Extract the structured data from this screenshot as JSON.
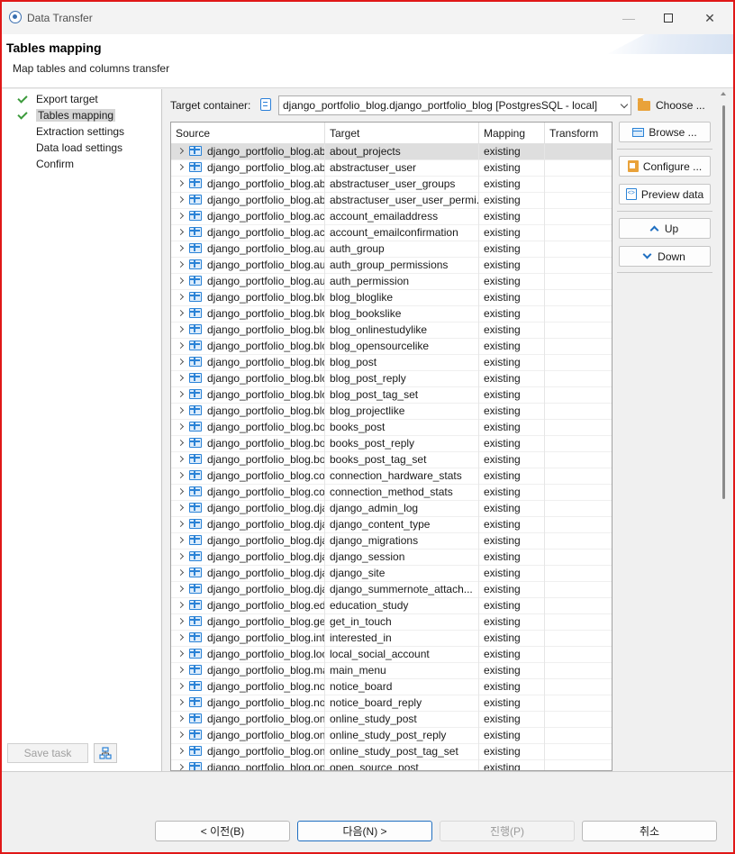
{
  "window": {
    "title": "Data Transfer"
  },
  "header": {
    "title": "Tables mapping",
    "subtitle": "Map tables and columns transfer"
  },
  "nav": {
    "items": [
      {
        "label": "Export target",
        "done": true
      },
      {
        "label": "Tables mapping",
        "done": true,
        "selected": true
      },
      {
        "label": "Extraction settings",
        "done": false
      },
      {
        "label": "Data load settings",
        "done": false
      },
      {
        "label": "Confirm",
        "done": false
      }
    ],
    "save_task_label": "Save task"
  },
  "target_container": {
    "label": "Target container:",
    "value": "django_portfolio_blog.django_portfolio_blog  [PostgresSQL - local]",
    "choose_label": "Choose ..."
  },
  "table": {
    "columns": [
      "Source",
      "Target",
      "Mapping",
      "Transform"
    ],
    "rows": [
      {
        "source": "django_portfolio_blog.about_projects",
        "target": "about_projects",
        "mapping": "existing",
        "transform": ""
      },
      {
        "source": "django_portfolio_blog.abstractuser_user",
        "target": "abstractuser_user",
        "mapping": "existing",
        "transform": ""
      },
      {
        "source": "django_portfolio_blog.abstractuser_user_groups",
        "target": "abstractuser_user_groups",
        "mapping": "existing",
        "transform": ""
      },
      {
        "source": "django_portfolio_blog.abstractuser_user_user_permissions",
        "target": "abstractuser_user_user_permi...",
        "mapping": "existing",
        "transform": ""
      },
      {
        "source": "django_portfolio_blog.account_emailaddress",
        "target": "account_emailaddress",
        "mapping": "existing",
        "transform": ""
      },
      {
        "source": "django_portfolio_blog.account_emailconfirmation",
        "target": "account_emailconfirmation",
        "mapping": "existing",
        "transform": ""
      },
      {
        "source": "django_portfolio_blog.auth_group",
        "target": "auth_group",
        "mapping": "existing",
        "transform": ""
      },
      {
        "source": "django_portfolio_blog.auth_group_permissions",
        "target": "auth_group_permissions",
        "mapping": "existing",
        "transform": ""
      },
      {
        "source": "django_portfolio_blog.auth_permission",
        "target": "auth_permission",
        "mapping": "existing",
        "transform": ""
      },
      {
        "source": "django_portfolio_blog.blog_bloglike",
        "target": "blog_bloglike",
        "mapping": "existing",
        "transform": ""
      },
      {
        "source": "django_portfolio_blog.blog_bookslike",
        "target": "blog_bookslike",
        "mapping": "existing",
        "transform": ""
      },
      {
        "source": "django_portfolio_blog.blog_onlinestudylike",
        "target": "blog_onlinestudylike",
        "mapping": "existing",
        "transform": ""
      },
      {
        "source": "django_portfolio_blog.blog_opensourcelike",
        "target": "blog_opensourcelike",
        "mapping": "existing",
        "transform": ""
      },
      {
        "source": "django_portfolio_blog.blog_post",
        "target": "blog_post",
        "mapping": "existing",
        "transform": ""
      },
      {
        "source": "django_portfolio_blog.blog_post_reply",
        "target": "blog_post_reply",
        "mapping": "existing",
        "transform": ""
      },
      {
        "source": "django_portfolio_blog.blog_post_tag_set",
        "target": "blog_post_tag_set",
        "mapping": "existing",
        "transform": ""
      },
      {
        "source": "django_portfolio_blog.blog_projectlike",
        "target": "blog_projectlike",
        "mapping": "existing",
        "transform": ""
      },
      {
        "source": "django_portfolio_blog.books_post",
        "target": "books_post",
        "mapping": "existing",
        "transform": ""
      },
      {
        "source": "django_portfolio_blog.books_post_reply",
        "target": "books_post_reply",
        "mapping": "existing",
        "transform": ""
      },
      {
        "source": "django_portfolio_blog.books_post_tag_set",
        "target": "books_post_tag_set",
        "mapping": "existing",
        "transform": ""
      },
      {
        "source": "django_portfolio_blog.connection_hardware_stats",
        "target": "connection_hardware_stats",
        "mapping": "existing",
        "transform": ""
      },
      {
        "source": "django_portfolio_blog.connection_method_stats",
        "target": "connection_method_stats",
        "mapping": "existing",
        "transform": ""
      },
      {
        "source": "django_portfolio_blog.django_admin_log",
        "target": "django_admin_log",
        "mapping": "existing",
        "transform": ""
      },
      {
        "source": "django_portfolio_blog.django_content_type",
        "target": "django_content_type",
        "mapping": "existing",
        "transform": ""
      },
      {
        "source": "django_portfolio_blog.django_migrations",
        "target": "django_migrations",
        "mapping": "existing",
        "transform": ""
      },
      {
        "source": "django_portfolio_blog.django_session",
        "target": "django_session",
        "mapping": "existing",
        "transform": ""
      },
      {
        "source": "django_portfolio_blog.django_site",
        "target": "django_site",
        "mapping": "existing",
        "transform": ""
      },
      {
        "source": "django_portfolio_blog.django_summernote_attachment",
        "target": "django_summernote_attach...",
        "mapping": "existing",
        "transform": ""
      },
      {
        "source": "django_portfolio_blog.education_study",
        "target": "education_study",
        "mapping": "existing",
        "transform": ""
      },
      {
        "source": "django_portfolio_blog.get_in_touch",
        "target": "get_in_touch",
        "mapping": "existing",
        "transform": ""
      },
      {
        "source": "django_portfolio_blog.interested_in",
        "target": "interested_in",
        "mapping": "existing",
        "transform": ""
      },
      {
        "source": "django_portfolio_blog.local_social_account",
        "target": "local_social_account",
        "mapping": "existing",
        "transform": ""
      },
      {
        "source": "django_portfolio_blog.main_menu",
        "target": "main_menu",
        "mapping": "existing",
        "transform": ""
      },
      {
        "source": "django_portfolio_blog.notice_board",
        "target": "notice_board",
        "mapping": "existing",
        "transform": ""
      },
      {
        "source": "django_portfolio_blog.notice_board_reply",
        "target": "notice_board_reply",
        "mapping": "existing",
        "transform": ""
      },
      {
        "source": "django_portfolio_blog.online_study_post",
        "target": "online_study_post",
        "mapping": "existing",
        "transform": ""
      },
      {
        "source": "django_portfolio_blog.online_study_post_reply",
        "target": "online_study_post_reply",
        "mapping": "existing",
        "transform": ""
      },
      {
        "source": "django_portfolio_blog.online_study_post_tag_set",
        "target": "online_study_post_tag_set",
        "mapping": "existing",
        "transform": ""
      },
      {
        "source": "django_portfolio_blog.open_source_post",
        "target": "open_source_post",
        "mapping": "existing",
        "transform": ""
      }
    ]
  },
  "side_buttons": {
    "browse": "Browse ...",
    "configure": "Configure ...",
    "preview": "Preview data",
    "up": "Up",
    "down": "Down"
  },
  "footer": {
    "back": "< 이전(B)",
    "next": "다음(N) >",
    "proceed": "진행(P)",
    "cancel": "취소"
  },
  "colors": {
    "accent": "#1f6fc1",
    "check": "#3b9a3b",
    "window_border": "#e01818"
  }
}
